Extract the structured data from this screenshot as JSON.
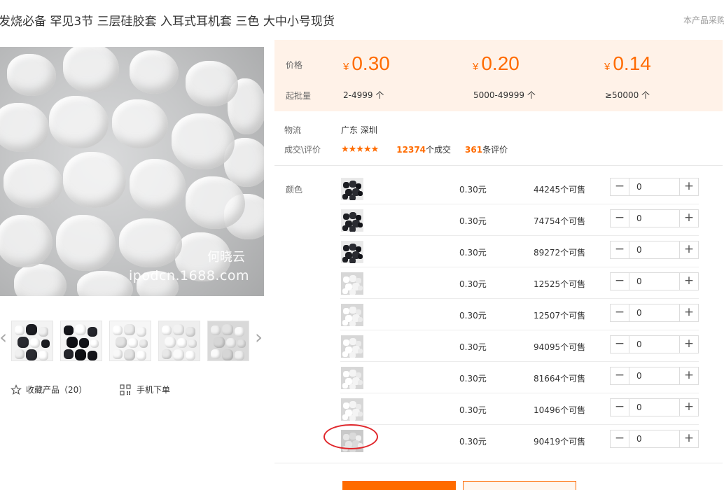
{
  "product": {
    "title": "发烧必备 罕见3节 三层硅胶套 入耳式耳机套 三色 大中小号现货",
    "note": "本产品采购",
    "watermark_name": "何晓云",
    "watermark_site": "ipodcn.1688.com"
  },
  "thumbs": {
    "prev_icon": "chevron-left-icon",
    "next_icon": "chevron-right-icon",
    "prev_glyph": "‹",
    "next_glyph": "›"
  },
  "actions": {
    "favorite_label": "收藏产品（20）",
    "favorite_icon": "star-outline-icon",
    "mobile_label": "手机下单",
    "mobile_icon": "qr-code-icon"
  },
  "pricing": {
    "price_label": "价格",
    "moq_label": "起批量",
    "currency": "¥",
    "tiers": [
      {
        "price": "0.30",
        "range": "2-4999 个"
      },
      {
        "price": "0.20",
        "range": "5000-49999 个"
      },
      {
        "price": "0.14",
        "range": "≥50000 个"
      }
    ]
  },
  "logistics": {
    "label": "物流",
    "value": "广东 深圳"
  },
  "reviews": {
    "label": "成交\\评价",
    "stars": "★★★★★",
    "rating": 4.5,
    "deals_count": "12374",
    "deals_suffix": "个成交",
    "review_count": "361",
    "review_suffix": "条评价"
  },
  "variants": {
    "label": "颜色",
    "minus": "−",
    "plus": "+",
    "rows": [
      {
        "price": "0.30元",
        "stock": "44245个可售",
        "qty": "0",
        "tone": "black"
      },
      {
        "price": "0.30元",
        "stock": "74754个可售",
        "qty": "0",
        "tone": "black"
      },
      {
        "price": "0.30元",
        "stock": "89272个可售",
        "qty": "0",
        "tone": "black"
      },
      {
        "price": "0.30元",
        "stock": "12525个可售",
        "qty": "0",
        "tone": "white"
      },
      {
        "price": "0.30元",
        "stock": "12507个可售",
        "qty": "0",
        "tone": "white"
      },
      {
        "price": "0.30元",
        "stock": "94095个可售",
        "qty": "0",
        "tone": "white"
      },
      {
        "price": "0.30元",
        "stock": "81664个可售",
        "qty": "0",
        "tone": "white"
      },
      {
        "price": "0.30元",
        "stock": "10496个可售",
        "qty": "0",
        "tone": "white"
      },
      {
        "price": "0.30元",
        "stock": "90419个可售",
        "qty": "0",
        "tone": "grey"
      }
    ]
  },
  "colors": {
    "accent": "#ff6b00",
    "price_bg": "#fff2e8",
    "highlight_circle": "#e0262b"
  }
}
